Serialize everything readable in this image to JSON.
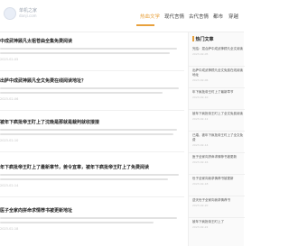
{
  "site": {
    "logo_line1": "单机之家",
    "logo_line2": "danji.com"
  },
  "nav": {
    "items": [
      {
        "label": "热血文学",
        "active": true
      },
      {
        "label": "现代言情",
        "active": false
      },
      {
        "label": "古代言情",
        "active": false
      },
      {
        "label": "都市",
        "active": false
      },
      {
        "label": "穿越",
        "active": false
      }
    ]
  },
  "articles": [
    {
      "title": "中成武神顾凡太祖苍曲全集免费阅读",
      "date": "2023-02-05"
    },
    {
      "title": "出萨中成武神顾凡全文免费在线阅读地址？",
      "date": "2023-02-06"
    },
    {
      "title": "被年下疯批帝王盯上了沈晚是那就是裁判就收接接",
      "date": "2023-02-10"
    },
    {
      "title": "年下疯批帝王盯上了最新章节，姜令宜章，被年下疯批帝王盯上了免费阅读",
      "date": "2023-02-14"
    },
    {
      "title": "医子全家向拼命求情荐书被更新地址",
      "date": "2023-02-18"
    }
  ],
  "sidebar": {
    "heading": "热门文章",
    "items": [
      {
        "title": "完结：混合萨中成武神顾凡全文阅读",
        "date": "2023-02-05"
      },
      {
        "title": "出萨中成武神顾凡全文免费在线阅读地址",
        "date": "2023-02-06"
      },
      {
        "title": "年下疯批帝王盯上了最新章节",
        "date": "2023-02-10"
      },
      {
        "title": "被年下疯批帝王盯上了全文免费阅读",
        "date": "2023-02-12"
      },
      {
        "title": "已婚，被年下疯批帝王盯上了全文免费",
        "date": "2023-02-14"
      },
      {
        "title": "医子全家向拼命求情荐书被更新",
        "date": "2023-02-16"
      },
      {
        "title": "世子全家向我求情荐书被更新",
        "date": "2023-02-18"
      },
      {
        "title": "逆天世子全家向我求情荐书",
        "date": "2023-02-20"
      },
      {
        "title": "被年下疯批帝王盯上了",
        "date": "2023-02-22"
      }
    ]
  }
}
